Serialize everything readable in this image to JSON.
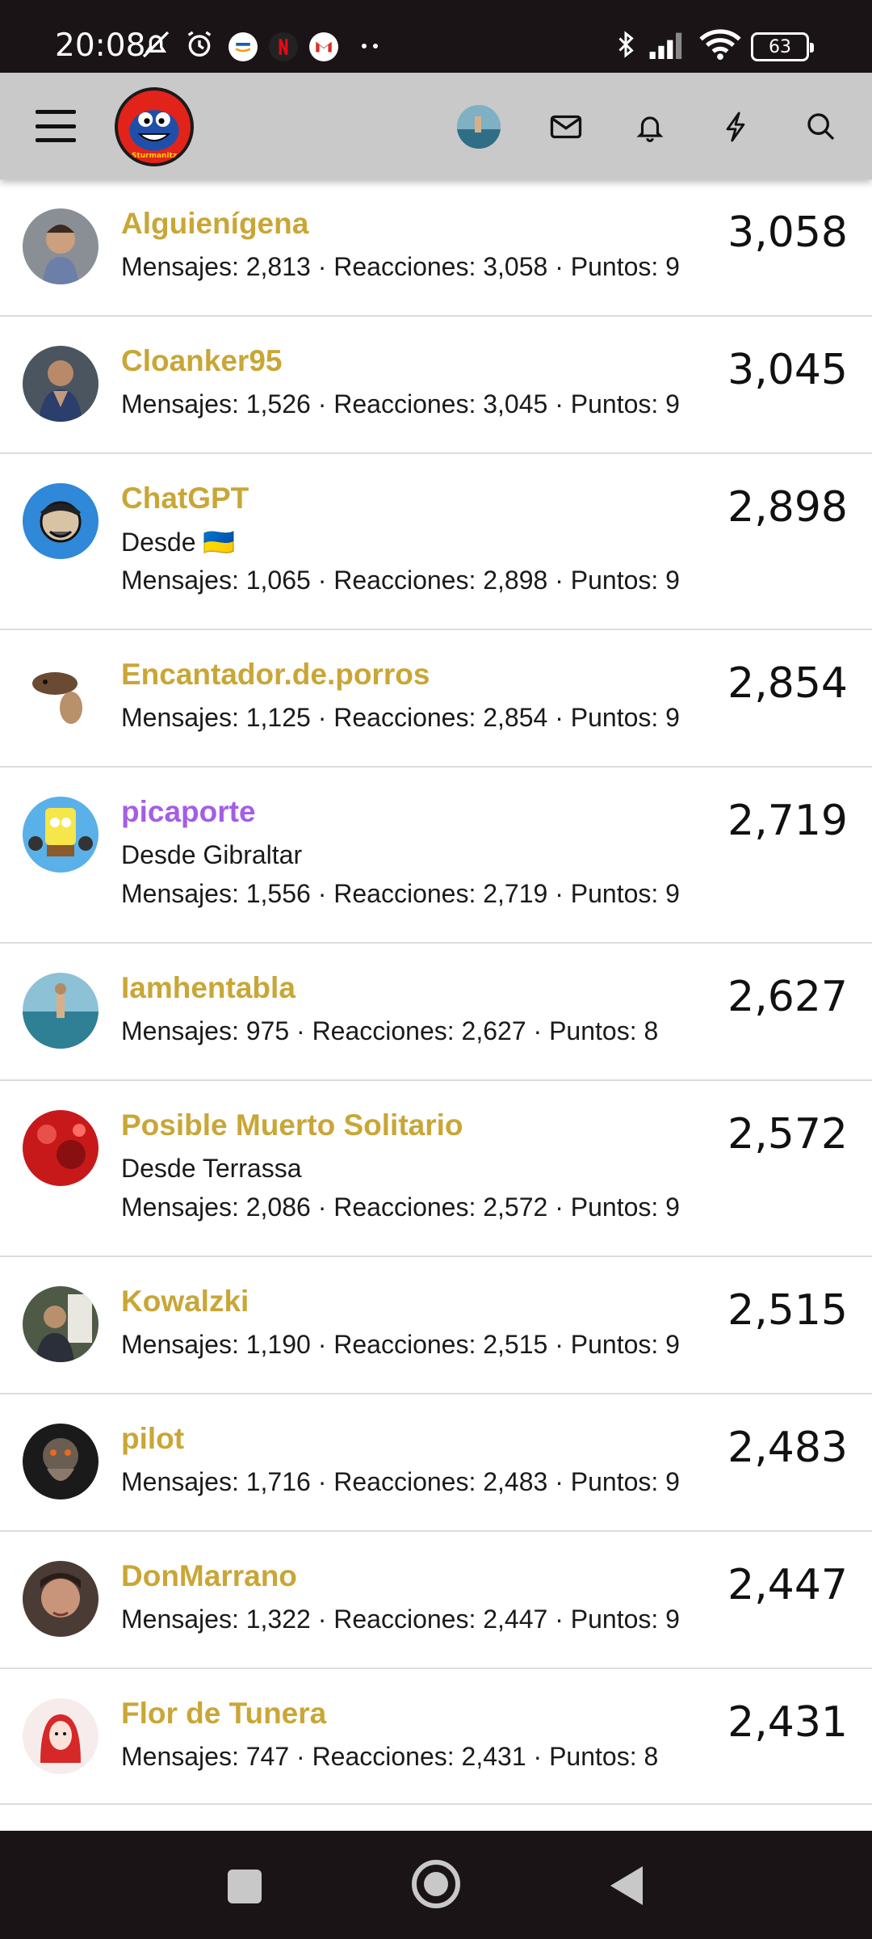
{
  "status_bar": {
    "time": "20:08",
    "battery": "63",
    "icons": [
      "mute-bell-icon",
      "alarm-icon",
      "amazon-app-icon",
      "netflix-app-icon",
      "gmail-app-icon",
      "more-dots-icon",
      "bluetooth-icon",
      "signal-icon",
      "wifi-icon",
      "battery-icon"
    ]
  },
  "header": {
    "logo_text": "Sturmanitz",
    "icons": [
      "menu-icon",
      "user-avatar",
      "mail-icon",
      "bell-icon",
      "lightning-icon",
      "search-icon"
    ]
  },
  "members": [
    {
      "name": "Alguienígena",
      "location": "",
      "stats": "Mensajes: 2,813 · Reacciones: 3,058 · Puntos: 9",
      "score": "3,058",
      "color": "#c9a636"
    },
    {
      "name": "Cloanker95",
      "location": "",
      "stats": "Mensajes: 1,526 · Reacciones: 3,045 · Puntos: 9",
      "score": "3,045",
      "color": "#c9a636"
    },
    {
      "name": "ChatGPT",
      "location": "Desde 🇺🇦",
      "stats": "Mensajes: 1,065 · Reacciones: 2,898 · Puntos: 9",
      "score": "2,898",
      "color": "#c9a636"
    },
    {
      "name": "Encantador.de.porros",
      "location": "",
      "stats": "Mensajes: 1,125 · Reacciones: 2,854 · Puntos: 9",
      "score": "2,854",
      "color": "#c9a636"
    },
    {
      "name": "picaporte",
      "location": "Desde Gibraltar",
      "stats": "Mensajes: 1,556 · Reacciones: 2,719 · Puntos: 9",
      "score": "2,719",
      "color": "#a45ee5"
    },
    {
      "name": "Iamhentabla",
      "location": "",
      "stats": "Mensajes: 975 · Reacciones: 2,627 · Puntos: 8",
      "score": "2,627",
      "color": "#c9a636"
    },
    {
      "name": "Posible Muerto Solitario",
      "location": "Desde Terrassa",
      "stats": "Mensajes: 2,086 · Reacciones: 2,572 · Puntos: 9",
      "score": "2,572",
      "color": "#c9a636"
    },
    {
      "name": "Kowalzki",
      "location": "",
      "stats": "Mensajes: 1,190 · Reacciones: 2,515 · Puntos: 9",
      "score": "2,515",
      "color": "#c9a636"
    },
    {
      "name": "pilot",
      "location": "",
      "stats": "Mensajes: 1,716 · Reacciones: 2,483 · Puntos: 9",
      "score": "2,483",
      "color": "#c9a636"
    },
    {
      "name": "DonMarrano",
      "location": "",
      "stats": "Mensajes: 1,322 · Reacciones: 2,447 · Puntos: 9",
      "score": "2,447",
      "color": "#c9a636"
    },
    {
      "name": "Flor de Tunera",
      "location": "",
      "stats": "Mensajes: 747 · Reacciones: 2,431 · Puntos: 8",
      "score": "2,431",
      "color": "#c9a636"
    }
  ],
  "nav": {
    "icons": [
      "recents-icon",
      "home-icon",
      "back-icon"
    ]
  }
}
